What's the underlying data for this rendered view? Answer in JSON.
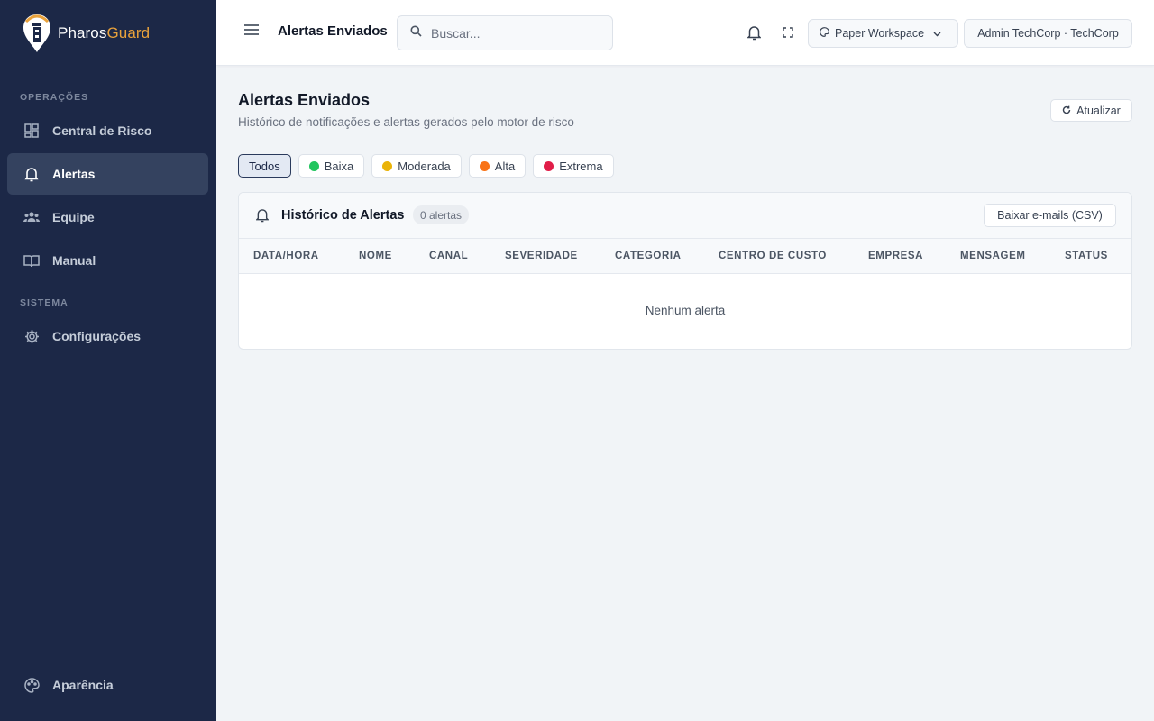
{
  "brand": {
    "name_part1": "Pharos",
    "name_part2": "Guard",
    "accent_color": "#e9a23b"
  },
  "sidebar": {
    "sections": [
      {
        "label": "OPERAÇÕES"
      },
      {
        "label": "SISTEMA"
      }
    ],
    "items": [
      {
        "label": "Central de Risco",
        "icon": "dashboard-icon"
      },
      {
        "label": "Alertas",
        "icon": "bell-icon",
        "active": true
      },
      {
        "label": "Equipe",
        "icon": "team-icon"
      },
      {
        "label": "Manual",
        "icon": "book-icon"
      },
      {
        "label": "Configurações",
        "icon": "gear-icon"
      }
    ],
    "appearance": {
      "label": "Aparência",
      "icon": "palette-icon"
    }
  },
  "header": {
    "title": "Alertas Enviados",
    "search_placeholder": "Buscar...",
    "workspace": "Paper Workspace",
    "account": "Admin TechCorp · TechCorp"
  },
  "page": {
    "title": "Alertas Enviados",
    "subtitle": "Histórico de notificações e alertas gerados pelo motor de risco",
    "refresh_label": "Atualizar"
  },
  "filters": [
    {
      "label": "Todos",
      "active": true
    },
    {
      "label": "Baixa",
      "color": "#22c55e"
    },
    {
      "label": "Moderada",
      "color": "#eab308"
    },
    {
      "label": "Alta",
      "color": "#f97316"
    },
    {
      "label": "Extrema",
      "color": "#e11d48"
    }
  ],
  "table": {
    "title": "Histórico de Alertas",
    "count_label": "0 alertas",
    "export_label": "Baixar e-mails (CSV)",
    "columns": [
      "DATA/HORA",
      "NOME",
      "CANAL",
      "SEVERIDADE",
      "CATEGORIA",
      "CENTRO DE CUSTO",
      "EMPRESA",
      "MENSAGEM",
      "STATUS"
    ],
    "empty_text": "Nenhum alerta"
  }
}
